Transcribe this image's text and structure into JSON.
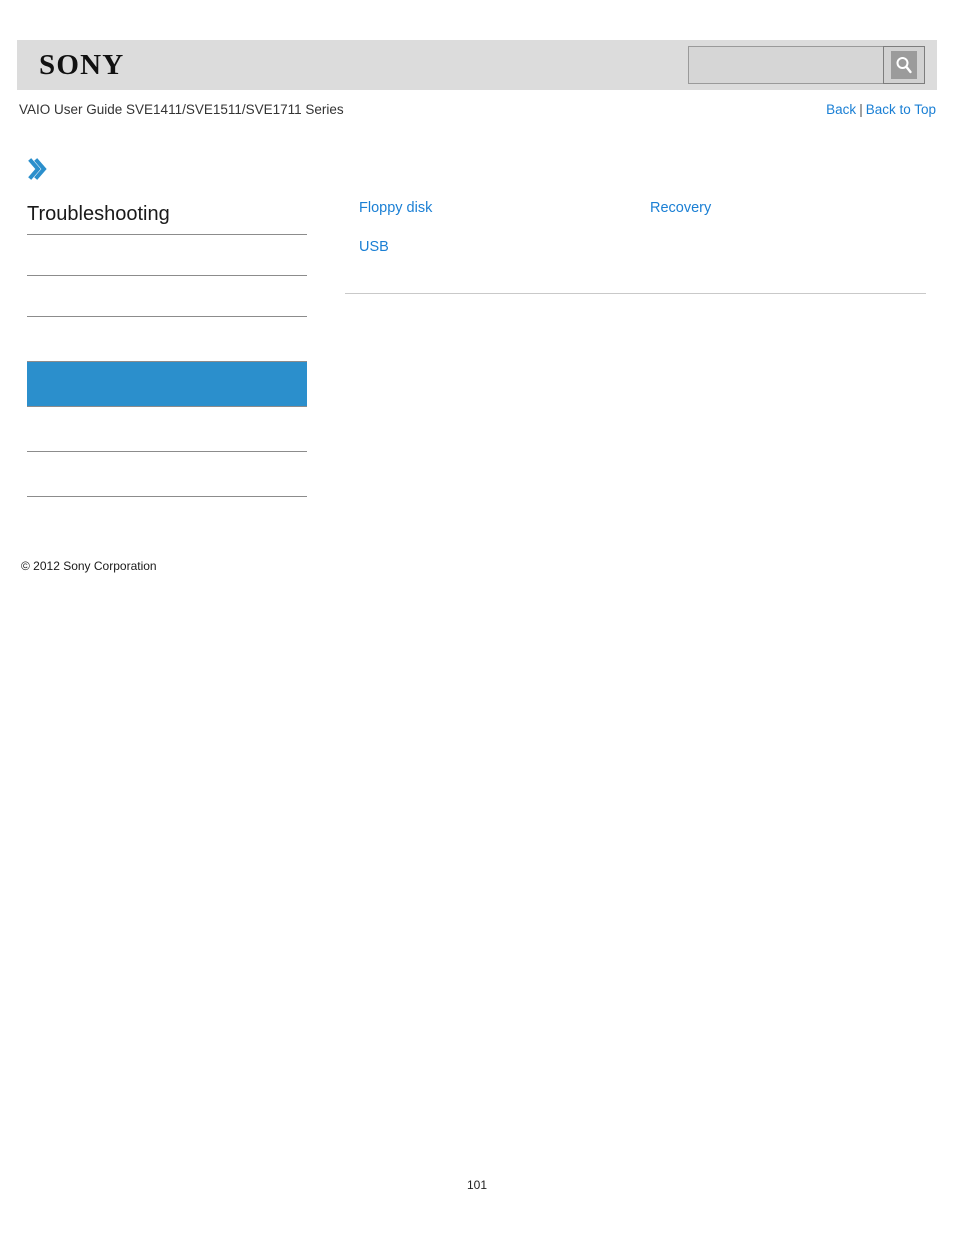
{
  "header": {
    "logo_text": "SONY",
    "search": {
      "value": "",
      "placeholder": "",
      "icon": "search-icon",
      "button_label": ""
    }
  },
  "subheader": {
    "title": "VAIO User Guide SVE1411/SVE1511/SVE1711 Series",
    "back_label": "Back",
    "separator": "|",
    "back_to_top_label": "Back to Top"
  },
  "sidebar": {
    "marker_icon": "double-chevron-right-icon",
    "title": "Troubleshooting",
    "items": [
      {
        "label": "",
        "state": "normal"
      },
      {
        "label": "",
        "state": "normal"
      },
      {
        "label": "",
        "state": "normal"
      },
      {
        "label": "",
        "state": "active"
      },
      {
        "label": "",
        "state": "normal"
      },
      {
        "label": "",
        "state": "normal"
      }
    ],
    "active_color": "#2b8fcc"
  },
  "content": {
    "links": [
      {
        "label": "Floppy disk",
        "column": 0
      },
      {
        "label": "Recovery",
        "column": 1
      },
      {
        "label": "USB",
        "column": 0
      }
    ],
    "link_color": "#1a7fd4"
  },
  "footer": {
    "copyright": "© 2012 Sony Corporation",
    "page_number": "101"
  }
}
